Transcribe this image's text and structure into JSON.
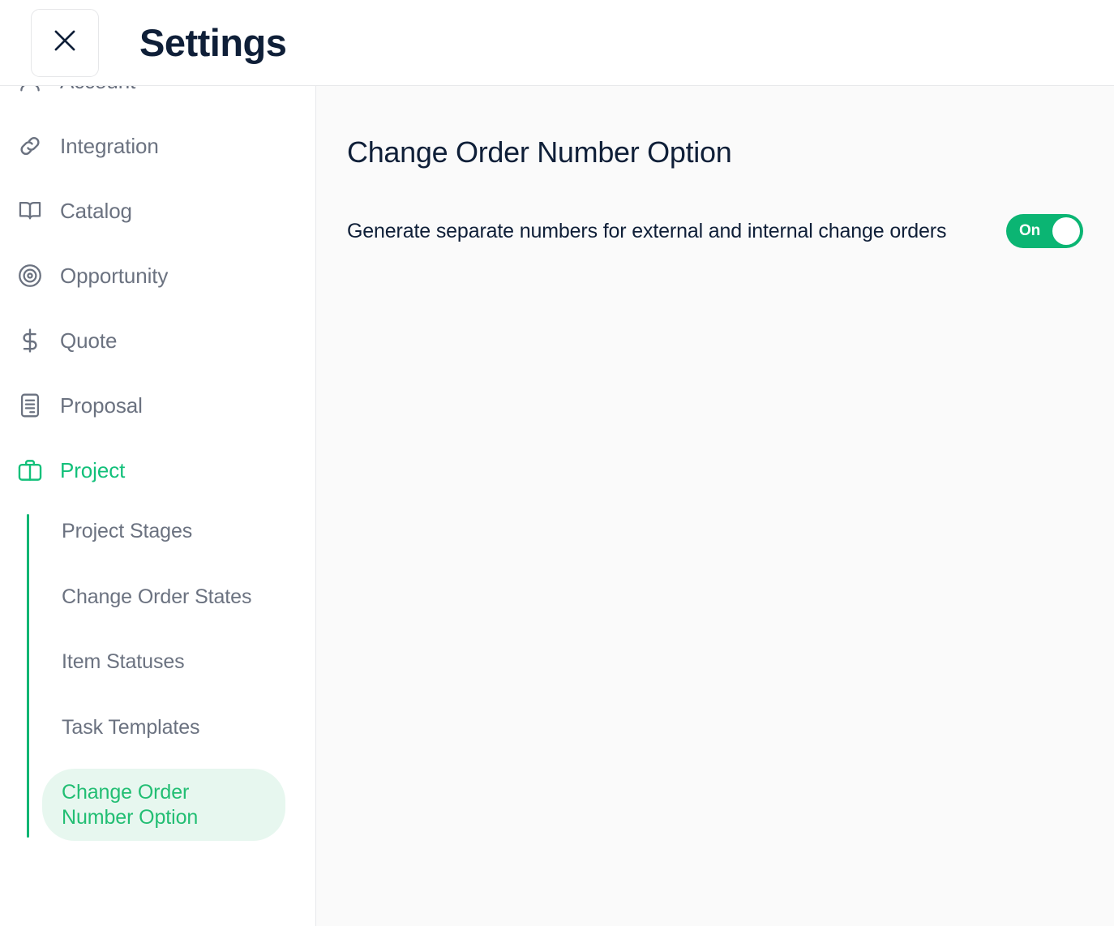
{
  "header": {
    "title": "Settings",
    "close_icon": "close-icon"
  },
  "sidebar": {
    "items": [
      {
        "label": "Account",
        "icon": "user-icon",
        "active": false
      },
      {
        "label": "Integration",
        "icon": "link-icon",
        "active": false
      },
      {
        "label": "Catalog",
        "icon": "book-icon",
        "active": false
      },
      {
        "label": "Opportunity",
        "icon": "target-icon",
        "active": false
      },
      {
        "label": "Quote",
        "icon": "dollar-icon",
        "active": false
      },
      {
        "label": "Proposal",
        "icon": "document-icon",
        "active": false
      },
      {
        "label": "Project",
        "icon": "briefcase-icon",
        "active": true
      }
    ],
    "submenu": [
      {
        "label": "Project Stages",
        "selected": false
      },
      {
        "label": "Change Order States",
        "selected": false
      },
      {
        "label": "Item Statuses",
        "selected": false
      },
      {
        "label": "Task Templates",
        "selected": false
      },
      {
        "label": "Change Order Number Option",
        "selected": true
      }
    ]
  },
  "main": {
    "title": "Change Order Number Option",
    "setting": {
      "label": "Generate separate numbers for external and internal change orders",
      "toggle_state": "On"
    }
  },
  "colors": {
    "accent_green": "#0bb573",
    "active_green": "#12c07a",
    "pill_background": "#e7f7ef",
    "pill_text": "#22be73",
    "title_navy": "#0f1f38",
    "muted_text": "#6b7280",
    "content_background": "#fafafa",
    "border": "#e8e9eb"
  }
}
